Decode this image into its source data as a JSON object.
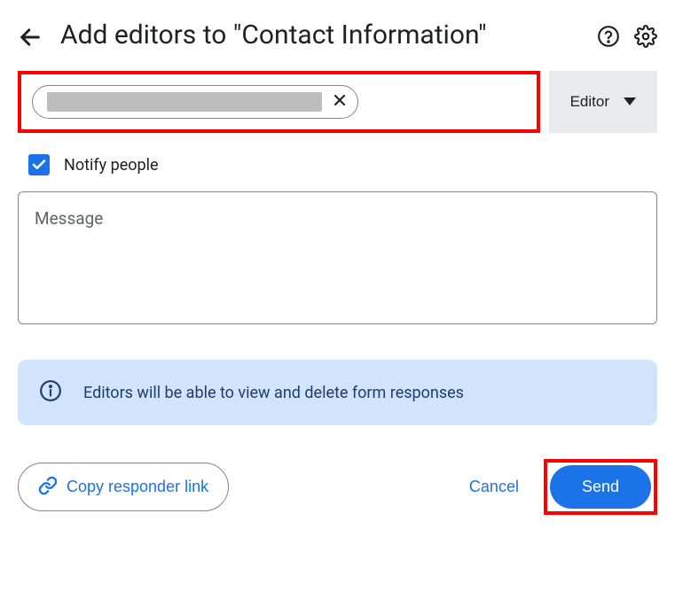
{
  "header": {
    "title": "Add editors to \"Contact Information\""
  },
  "role_dropdown": {
    "selected": "Editor"
  },
  "notify": {
    "label": "Notify people",
    "checked": true
  },
  "message": {
    "placeholder": "Message",
    "value": ""
  },
  "info_banner": {
    "text": "Editors will be able to view and delete form responses"
  },
  "footer": {
    "copy_link": "Copy responder link",
    "cancel": "Cancel",
    "send": "Send"
  },
  "highlights": {
    "people_input": true,
    "send_button": true
  }
}
